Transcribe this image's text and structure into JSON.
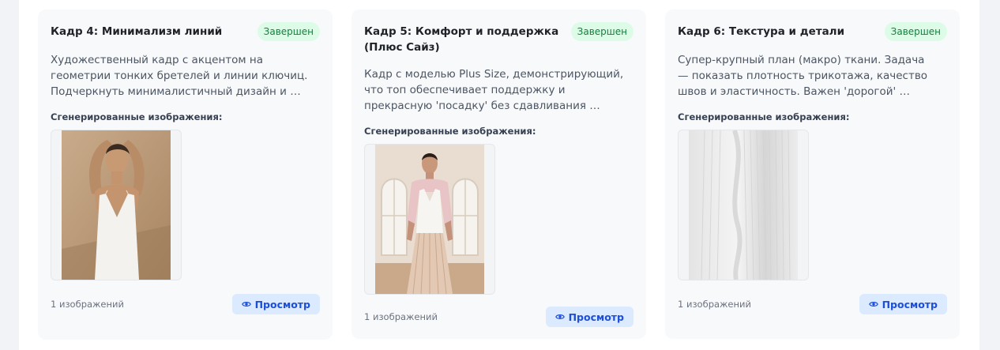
{
  "cards": [
    {
      "title": "Кадр 4: Минимализм линий",
      "status": "Завершен",
      "description": "Художественный кадр с акцентом на геометрии тонких бретелей и линии ключиц. Подчеркнуть минималистичный дизайн и …",
      "generated_label": "Сгенерированные изображения:",
      "image_count": "1 изображений",
      "view_label": "Просмотр"
    },
    {
      "title": "Кадр 5: Комфорт и поддержка (Плюс Сайз)",
      "status": "Завершен",
      "description": "Кадр с моделью Plus Size, демонстрирующий, что топ обеспечивает поддержку и прекрасную 'посадку' без сдавливания …",
      "generated_label": "Сгенерированные изображения:",
      "image_count": "1 изображений",
      "view_label": "Просмотр"
    },
    {
      "title": "Кадр 6: Текстура и детали",
      "status": "Завершен",
      "description": "Супер-крупный план (макро) ткани. Задача — показать плотность трикотажа, качество швов и эластичность. Важен 'дорогой' …",
      "generated_label": "Сгенерированные изображения:",
      "image_count": "1 изображений",
      "view_label": "Просмотр"
    }
  ],
  "colors": {
    "badge_bg": "#dcfce7",
    "badge_text": "#15803d",
    "button_bg": "#dbeafe",
    "button_text": "#1d4ed8"
  },
  "icons": {
    "view_button": "eye-icon"
  }
}
